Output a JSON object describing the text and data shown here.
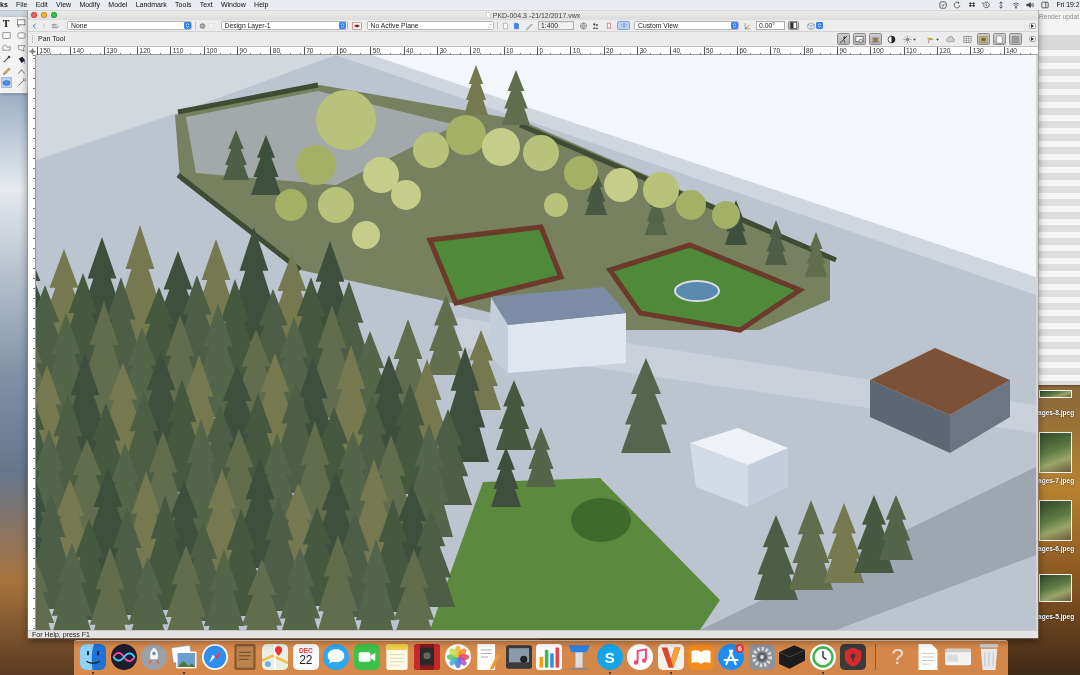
{
  "menu_bar": {
    "app_name": "ks",
    "menus": [
      "File",
      "Edit",
      "View",
      "Modify",
      "Model",
      "Landmark",
      "Tools",
      "Text",
      "Window",
      "Help"
    ],
    "clock": "Fri 19:2"
  },
  "tool_palette": {
    "tools": [
      {
        "kind": "text",
        "glyph": "T",
        "selected": false
      },
      {
        "kind": "callout",
        "selected": false
      },
      {
        "kind": "rectangle",
        "selected": false
      },
      {
        "kind": "rounded-rectangle",
        "selected": false
      },
      {
        "kind": "polygon",
        "selected": false
      },
      {
        "kind": "freeform",
        "selected": false
      },
      {
        "kind": "eyedropper",
        "selected": false
      },
      {
        "kind": "bucket",
        "selected": false
      },
      {
        "kind": "pencil",
        "selected": false
      },
      {
        "kind": "angle",
        "selected": false
      },
      {
        "kind": "oval",
        "selected": true
      },
      {
        "kind": "line",
        "selected": false
      }
    ]
  },
  "window": {
    "title": "PKD-004.3 -21/12/2017.vwx"
  },
  "view_bar": {
    "class": "None",
    "layer": "Design Layer-1",
    "plane": "No Active Plane",
    "scale": "1:400",
    "view": "Custom View",
    "rotation": "0.00°"
  },
  "mode_bar": {
    "tool_name": "Pan Tool",
    "view_buttons": [
      {
        "kind": "flyover",
        "pressed": true
      },
      {
        "kind": "monitor",
        "pressed": true
      },
      {
        "kind": "bug",
        "pressed": true
      },
      {
        "kind": "contrast",
        "pressed": false
      },
      {
        "kind": "sun",
        "pressed": false
      },
      {
        "kind": "lamp",
        "pressed": false
      },
      {
        "kind": "cloud",
        "pressed": false
      },
      {
        "kind": "grid",
        "pressed": false
      },
      {
        "kind": "frame",
        "pressed": true
      },
      {
        "kind": "page",
        "pressed": true
      },
      {
        "kind": "panel",
        "pressed": true
      }
    ]
  },
  "ruler": {
    "labels": [
      "150",
      "140",
      "130",
      "120",
      "110",
      "100",
      "90",
      "80",
      "70",
      "60",
      "50",
      "40",
      "30",
      "20",
      "10",
      "0",
      "10",
      "20",
      "30",
      "40",
      "50",
      "60",
      "70",
      "80",
      "90",
      "100",
      "110",
      "120",
      "130",
      "140"
    ]
  },
  "status_bar": {
    "text": "For Help, press F1"
  },
  "render_window": {
    "title": "Render updat"
  },
  "desktop_files": [
    {
      "name": "ages-8.jpeg"
    },
    {
      "name": "ages-7.jpeg"
    },
    {
      "name": "ages-6.jpeg"
    },
    {
      "name": "ages-5.jpeg"
    }
  ],
  "dock": {
    "items": [
      {
        "kind": "face",
        "running": true
      },
      {
        "kind": "orb",
        "running": false
      },
      {
        "kind": "rocket",
        "running": false
      },
      {
        "kind": "photos",
        "running": true
      },
      {
        "kind": "compass",
        "running": false
      },
      {
        "kind": "notebook",
        "running": false
      },
      {
        "kind": "map",
        "running": false
      },
      {
        "kind": "calendar",
        "month": "DEC",
        "day": "22",
        "running": false
      },
      {
        "kind": "bubble",
        "running": false
      },
      {
        "kind": "camera",
        "running": false
      },
      {
        "kind": "notepad",
        "running": false
      },
      {
        "kind": "booth",
        "running": false
      },
      {
        "kind": "flower",
        "running": false
      },
      {
        "kind": "paper",
        "running": false
      },
      {
        "kind": "frame",
        "running": false
      },
      {
        "kind": "chart",
        "running": false
      },
      {
        "kind": "podium",
        "running": false
      },
      {
        "kind": "letter",
        "glyph": "S",
        "running": true
      },
      {
        "kind": "music",
        "running": false
      },
      {
        "kind": "v-mark",
        "running": true
      },
      {
        "kind": "book",
        "running": false
      },
      {
        "kind": "store",
        "badge": "6",
        "running": false
      },
      {
        "kind": "gear",
        "running": false
      },
      {
        "kind": "device",
        "running": false
      },
      {
        "kind": "clock",
        "running": true
      },
      {
        "kind": "shield",
        "running": false
      },
      {
        "kind": "separator"
      },
      {
        "kind": "glyph",
        "glyph": "?",
        "running": false
      },
      {
        "kind": "document",
        "running": false
      },
      {
        "kind": "window",
        "running": false
      },
      {
        "kind": "trash",
        "running": false
      }
    ]
  }
}
